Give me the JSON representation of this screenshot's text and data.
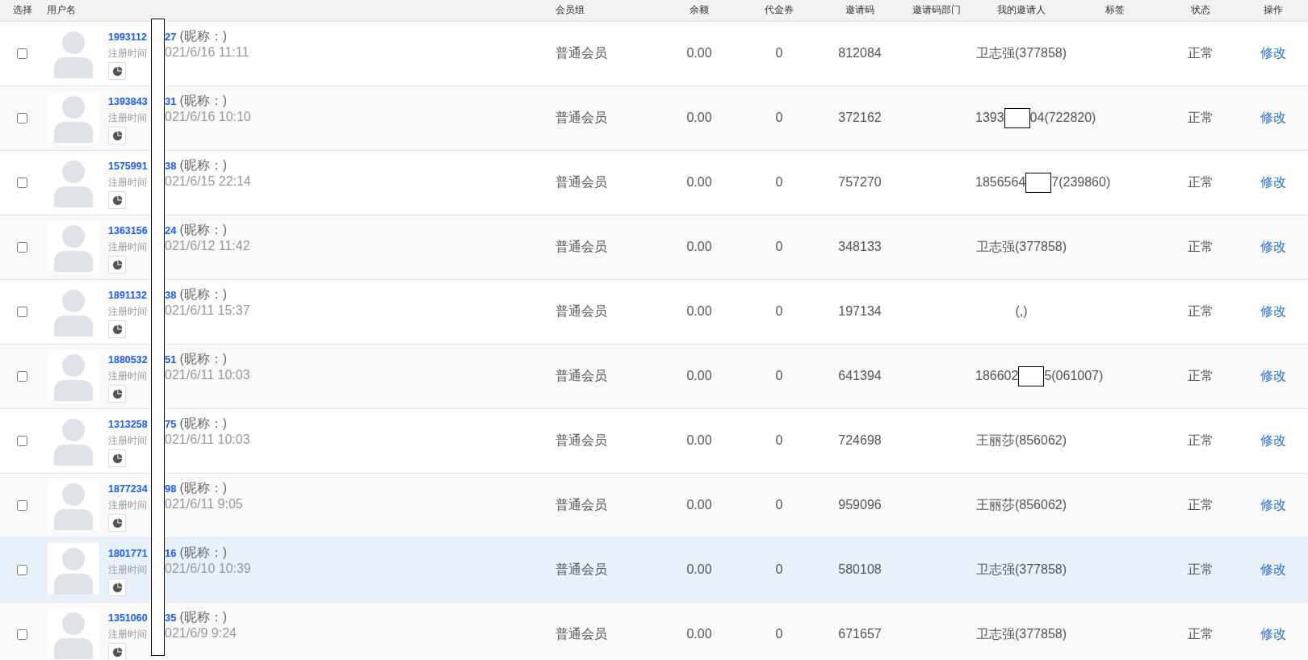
{
  "columns": [
    "选择",
    "用户名",
    "会员组",
    "余额",
    "代金券",
    "邀请码",
    "邀请码部门",
    "我的邀请人",
    "标签",
    "状态",
    "操作"
  ],
  "rows": [
    {
      "selected": false,
      "hovered": false,
      "username_head": "1993112",
      "username_tail": "27",
      "nickname": "(昵称：)",
      "reg_label": "注册时间",
      "reg_tail": "021/6/16 11:11",
      "group": "普通会员",
      "balance": "0.00",
      "voucher": "0",
      "invite_code": "812084",
      "inviter": [
        "卫志强(377858)"
      ],
      "status": "正常",
      "action": "修改"
    },
    {
      "selected": false,
      "hovered": false,
      "username_head": "1393843",
      "username_tail": "31",
      "nickname": "(昵称：)",
      "reg_label": "注册时间",
      "reg_tail": "021/6/16 10:10",
      "group": "普通会员",
      "balance": "0.00",
      "voucher": "0",
      "invite_code": "372162",
      "inviter": [
        "1393",
        "04(722820)"
      ],
      "status": "正常",
      "action": "修改"
    },
    {
      "selected": false,
      "hovered": false,
      "username_head": "1575991",
      "username_tail": "38",
      "nickname": "(昵称：)",
      "reg_label": "注册时间",
      "reg_tail": "021/6/15 22:14",
      "group": "普通会员",
      "balance": "0.00",
      "voucher": "0",
      "invite_code": "757270",
      "inviter": [
        "1856564",
        "7(239860)"
      ],
      "status": "正常",
      "action": "修改"
    },
    {
      "selected": false,
      "hovered": false,
      "username_head": "1363156",
      "username_tail": "24",
      "nickname": "(昵称：)",
      "reg_label": "注册时间",
      "reg_tail": "021/6/12 11:42",
      "group": "普通会员",
      "balance": "0.00",
      "voucher": "0",
      "invite_code": "348133",
      "inviter": [
        "卫志强(377858)"
      ],
      "status": "正常",
      "action": "修改"
    },
    {
      "selected": false,
      "hovered": false,
      "username_head": "1891132",
      "username_tail": "38",
      "nickname": "(昵称：)",
      "reg_label": "注册时间",
      "reg_tail": "021/6/11 15:37",
      "group": "普通会员",
      "balance": "0.00",
      "voucher": "0",
      "invite_code": "197134",
      "inviter": [
        "(,)"
      ],
      "status": "正常",
      "action": "修改"
    },
    {
      "selected": false,
      "hovered": false,
      "username_head": "1880532",
      "username_tail": "51",
      "nickname": "(昵称：)",
      "reg_label": "注册时间",
      "reg_tail": "021/6/11 10:03",
      "group": "普通会员",
      "balance": "0.00",
      "voucher": "0",
      "invite_code": "641394",
      "inviter": [
        "186602",
        "5(061007)"
      ],
      "status": "正常",
      "action": "修改"
    },
    {
      "selected": false,
      "hovered": false,
      "username_head": "1313258",
      "username_tail": "75",
      "nickname": "(昵称：)",
      "reg_label": "注册时间",
      "reg_tail": "021/6/11 10:03",
      "group": "普通会员",
      "balance": "0.00",
      "voucher": "0",
      "invite_code": "724698",
      "inviter": [
        "王丽莎(856062)"
      ],
      "status": "正常",
      "action": "修改"
    },
    {
      "selected": false,
      "hovered": false,
      "username_head": "1877234",
      "username_tail": "98",
      "nickname": "(昵称：)",
      "reg_label": "注册时间",
      "reg_tail": "021/6/11 9:05",
      "group": "普通会员",
      "balance": "0.00",
      "voucher": "0",
      "invite_code": "959096",
      "inviter": [
        "王丽莎(856062)"
      ],
      "status": "正常",
      "action": "修改"
    },
    {
      "selected": false,
      "hovered": true,
      "username_head": "1801771",
      "username_tail": "16",
      "nickname": "(昵称：)",
      "reg_label": "注册时间",
      "reg_tail": "021/6/10 10:39",
      "group": "普通会员",
      "balance": "0.00",
      "voucher": "0",
      "invite_code": "580108",
      "inviter": [
        "卫志强(377858)"
      ],
      "status": "正常",
      "action": "修改"
    },
    {
      "selected": false,
      "hovered": false,
      "username_head": "1351060",
      "username_tail": "35",
      "nickname": "(昵称：)",
      "reg_label": "注册时间",
      "reg_tail": "021/6/9 9:24",
      "group": "普通会员",
      "balance": "0.00",
      "voucher": "0",
      "invite_code": "671657",
      "inviter": [
        "卫志强(377858)"
      ],
      "status": "正常",
      "action": "修改"
    }
  ]
}
